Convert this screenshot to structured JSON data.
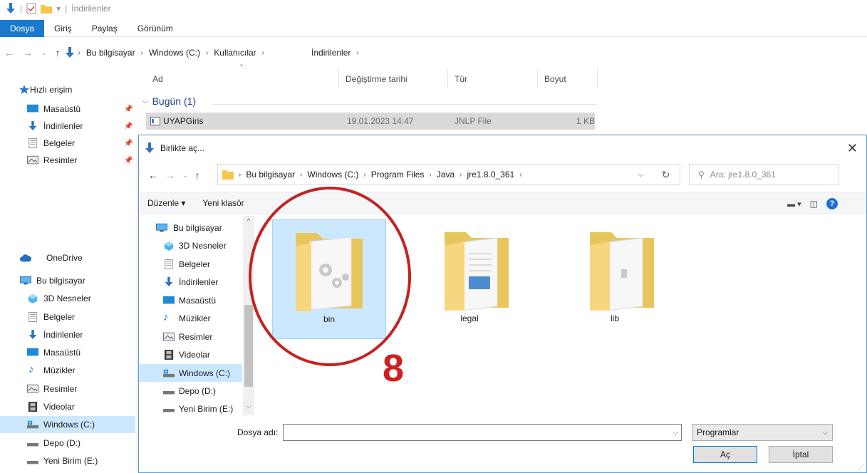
{
  "explorer": {
    "title": "İndirilenler",
    "ribbon_tabs": [
      "Dosya",
      "Giriş",
      "Paylaş",
      "Görünüm"
    ],
    "address": [
      "Bu bilgisayar",
      "Windows (C:)",
      "Kullanıcılar",
      "İndirilenler"
    ],
    "columns": {
      "name": "Ad",
      "date": "Değiştirme tarihi",
      "type": "Tür",
      "size": "Boyut"
    },
    "group": "Bugün (1)",
    "file": {
      "name": "UYAPGiris",
      "date": "19.01.2023 14:47",
      "type": "JNLP File",
      "size": "1 KB"
    },
    "quick_access": {
      "label": "Hızlı erişim",
      "items": [
        "Masaüstü",
        "İndirilenler",
        "Belgeler",
        "Resimler"
      ]
    },
    "onedrive": "OneDrive",
    "this_pc": {
      "label": "Bu bilgisayar",
      "items": [
        "3D Nesneler",
        "Belgeler",
        "İndirilenler",
        "Masaüstü",
        "Müzikler",
        "Resimler",
        "Videolar",
        "Windows (C:)",
        "Depo (D:)",
        "Yeni Birim (E:)"
      ]
    }
  },
  "dialog": {
    "title": "Birlikte aç...",
    "address": [
      "Bu bilgisayar",
      "Windows (C:)",
      "Program Files",
      "Java",
      "jre1.8.0_361"
    ],
    "search_placeholder": "Ara: jre1.8.0_361",
    "toolbar": {
      "organize": "Düzenle ▾",
      "new_folder": "Yeni klasör"
    },
    "nav": [
      "Bu bilgisayar",
      "3D Nesneler",
      "Belgeler",
      "İndirilenler",
      "Masaüstü",
      "Müzikler",
      "Resimler",
      "Videolar",
      "Windows (C:)",
      "Depo (D:)",
      "Yeni Birim (E:)"
    ],
    "folders": [
      "bin",
      "legal",
      "lib"
    ],
    "filename_label": "Dosya adı:",
    "filename_value": "",
    "file_type": "Programlar",
    "open_button": "Aç",
    "cancel_button": "İptal"
  },
  "annotation": {
    "number": "8"
  },
  "colors": {
    "accent": "#1979ca",
    "selection": "#cce8ff",
    "annotation": "#c42222",
    "folder": "#f5d57a"
  }
}
